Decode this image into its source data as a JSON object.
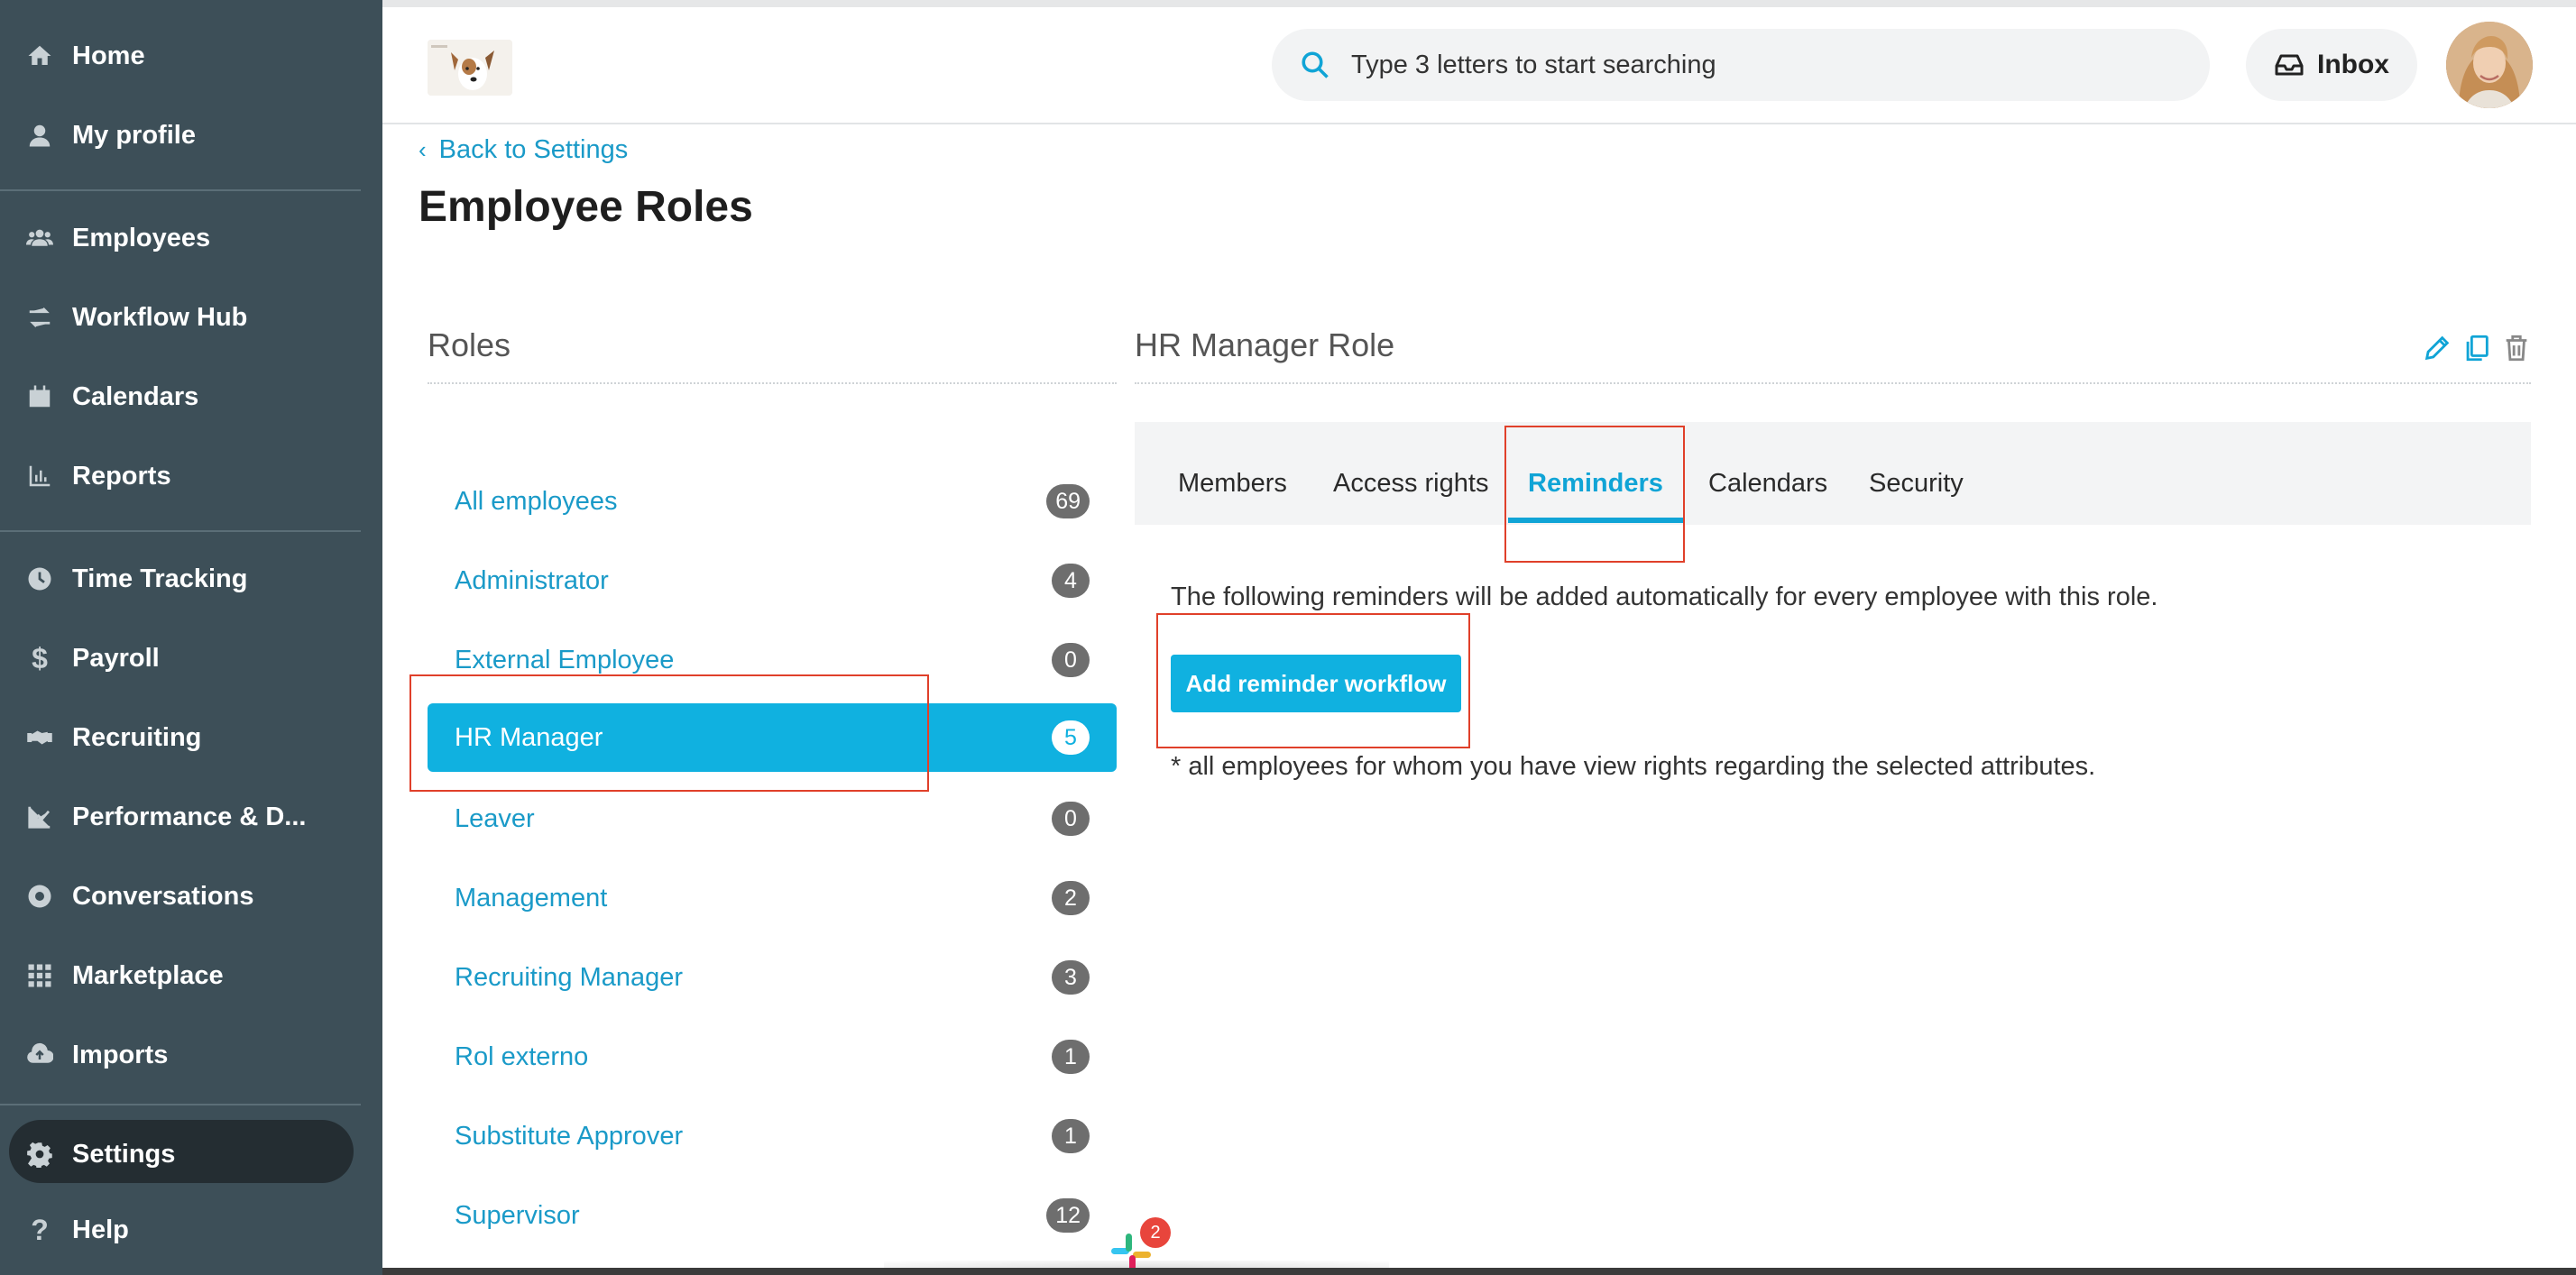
{
  "sidebar": {
    "items": [
      {
        "label": "Home",
        "icon": "home-icon"
      },
      {
        "label": "My profile",
        "icon": "user-icon"
      },
      {
        "label": "Employees",
        "icon": "people-icon"
      },
      {
        "label": "Workflow Hub",
        "icon": "workflow-icon"
      },
      {
        "label": "Calendars",
        "icon": "calendar-icon"
      },
      {
        "label": "Reports",
        "icon": "chart-icon"
      },
      {
        "label": "Time Tracking",
        "icon": "clock-icon"
      },
      {
        "label": "Payroll",
        "icon": "dollar-icon"
      },
      {
        "label": "Recruiting",
        "icon": "handshake-icon"
      },
      {
        "label": "Performance & D...",
        "icon": "trend-icon"
      },
      {
        "label": "Conversations",
        "icon": "lifebuoy-icon"
      },
      {
        "label": "Marketplace",
        "icon": "grid-icon"
      },
      {
        "label": "Imports",
        "icon": "cloud-upload-icon"
      },
      {
        "label": "Settings",
        "icon": "gear-icon"
      },
      {
        "label": "Help",
        "icon": "question-icon"
      }
    ]
  },
  "header": {
    "search_placeholder": "Type 3 letters to start searching",
    "inbox_label": "Inbox"
  },
  "page": {
    "back_label": "Back to Settings",
    "title": "Employee Roles"
  },
  "roles": {
    "title": "Roles",
    "items": [
      {
        "name": "All employees",
        "count": "69"
      },
      {
        "name": "Administrator",
        "count": "4"
      },
      {
        "name": "External Employee",
        "count": "0"
      },
      {
        "name": "HR Manager",
        "count": "5"
      },
      {
        "name": "Leaver",
        "count": "0"
      },
      {
        "name": "Management",
        "count": "2"
      },
      {
        "name": "Recruiting Manager",
        "count": "3"
      },
      {
        "name": "Rol externo",
        "count": "1"
      },
      {
        "name": "Substitute Approver",
        "count": "1"
      },
      {
        "name": "Supervisor",
        "count": "12"
      }
    ],
    "selected": "HR Manager"
  },
  "detail": {
    "title": "HR Manager Role",
    "tabs": [
      "Members",
      "Access rights",
      "Reminders",
      "Calendars",
      "Security"
    ],
    "active_tab": "Reminders",
    "description": "The following reminders will be added automatically for every employee with this role.",
    "add_button": "Add reminder workflow",
    "note": "* all employees for whom you have view rights regarding the selected attributes."
  },
  "dock": {
    "slack_badge": "2"
  },
  "colors": {
    "sidebar_bg": "#3d4f58",
    "accent": "#10b1e0",
    "link": "#1a9ac8",
    "highlight": "#e0402a"
  }
}
